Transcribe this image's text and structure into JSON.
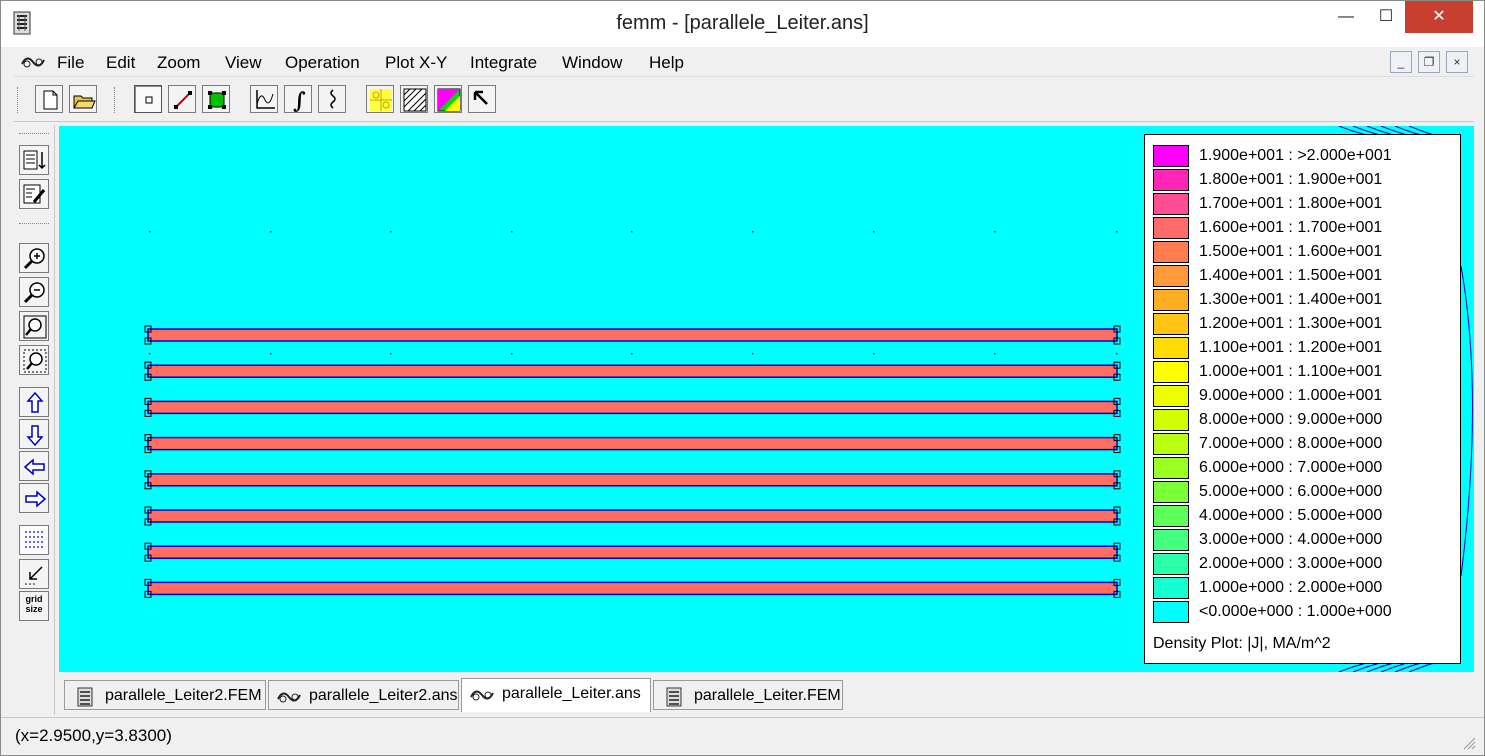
{
  "window": {
    "title": "femm - [parallele_Leiter.ans]",
    "controls": {
      "minimize": "—",
      "maximize": "☐",
      "close": "✕"
    }
  },
  "menu": {
    "items": [
      "File",
      "Edit",
      "Zoom",
      "View",
      "Operation",
      "Plot X-Y",
      "Integrate",
      "Window",
      "Help"
    ],
    "mdi_controls": {
      "minimize": "_",
      "restore": "❐",
      "close": "×"
    }
  },
  "toolbar": {
    "buttons": [
      "new-file",
      "open-file",
      "select-nodes",
      "select-segments",
      "select-blocks",
      "plot-x-y",
      "integrate",
      "line-integral",
      "contour-plot",
      "density-plot",
      "vector-plot",
      "pointer"
    ]
  },
  "left_toolbar": {
    "buttons": [
      "show-results",
      "edit-properties",
      "zoom-in",
      "zoom-out",
      "zoom-natural",
      "zoom-window",
      "pan-up",
      "pan-down",
      "pan-left",
      "pan-right",
      "show-grid",
      "snap-grid",
      "grid-size"
    ],
    "grid_size_label": [
      "grid",
      "size"
    ]
  },
  "plot": {
    "background_color": "#00ffff",
    "conductor_fill": "#ff6f61",
    "conductor_outline": "#0000c8",
    "conductor_count": 8
  },
  "legend": {
    "entries": [
      {
        "range": "1.900e+001 : >2.000e+001",
        "color": "#ff00ff"
      },
      {
        "range": "1.800e+001 : 1.900e+001",
        "color": "#ff26b8"
      },
      {
        "range": "1.700e+001 : 1.800e+001",
        "color": "#ff4d94"
      },
      {
        "range": "1.600e+001 : 1.700e+001",
        "color": "#ff6b6b"
      },
      {
        "range": "1.500e+001 : 1.600e+001",
        "color": "#ff7d50"
      },
      {
        "range": "1.400e+001 : 1.500e+001",
        "color": "#ff9a3c"
      },
      {
        "range": "1.300e+001 : 1.400e+001",
        "color": "#ffad22"
      },
      {
        "range": "1.200e+001 : 1.300e+001",
        "color": "#ffc414"
      },
      {
        "range": "1.100e+001 : 1.200e+001",
        "color": "#ffdc05"
      },
      {
        "range": "1.000e+001 : 1.100e+001",
        "color": "#ffff00"
      },
      {
        "range": "9.000e+000 : 1.000e+001",
        "color": "#ecff00"
      },
      {
        "range": "8.000e+000 : 9.000e+000",
        "color": "#d2ff00"
      },
      {
        "range": "7.000e+000 : 8.000e+000",
        "color": "#b8ff12"
      },
      {
        "range": "6.000e+000 : 7.000e+000",
        "color": "#9cff22"
      },
      {
        "range": "5.000e+000 : 6.000e+000",
        "color": "#7dff38"
      },
      {
        "range": "4.000e+000 : 5.000e+000",
        "color": "#5eff5a"
      },
      {
        "range": "3.000e+000 : 4.000e+000",
        "color": "#44ff80"
      },
      {
        "range": "2.000e+000 : 3.000e+000",
        "color": "#2affaa"
      },
      {
        "range": "1.000e+000 : 2.000e+000",
        "color": "#15ffd2"
      },
      {
        "range": "<0.000e+000 : 1.000e+000",
        "color": "#00ffff"
      }
    ],
    "title": "Density Plot: |J|, MA/m^2"
  },
  "tabs": [
    {
      "label": "parallele_Leiter2.FEM",
      "icon": "femm-doc-icon",
      "active": false
    },
    {
      "label": "parallele_Leiter2.ans",
      "icon": "femm-view-icon",
      "active": false
    },
    {
      "label": "parallele_Leiter.ans",
      "icon": "femm-view-icon",
      "active": true
    },
    {
      "label": "parallele_Leiter.FEM",
      "icon": "femm-doc-icon",
      "active": false
    }
  ],
  "status": {
    "coords": "(x=2.9500,y=3.8300)"
  }
}
